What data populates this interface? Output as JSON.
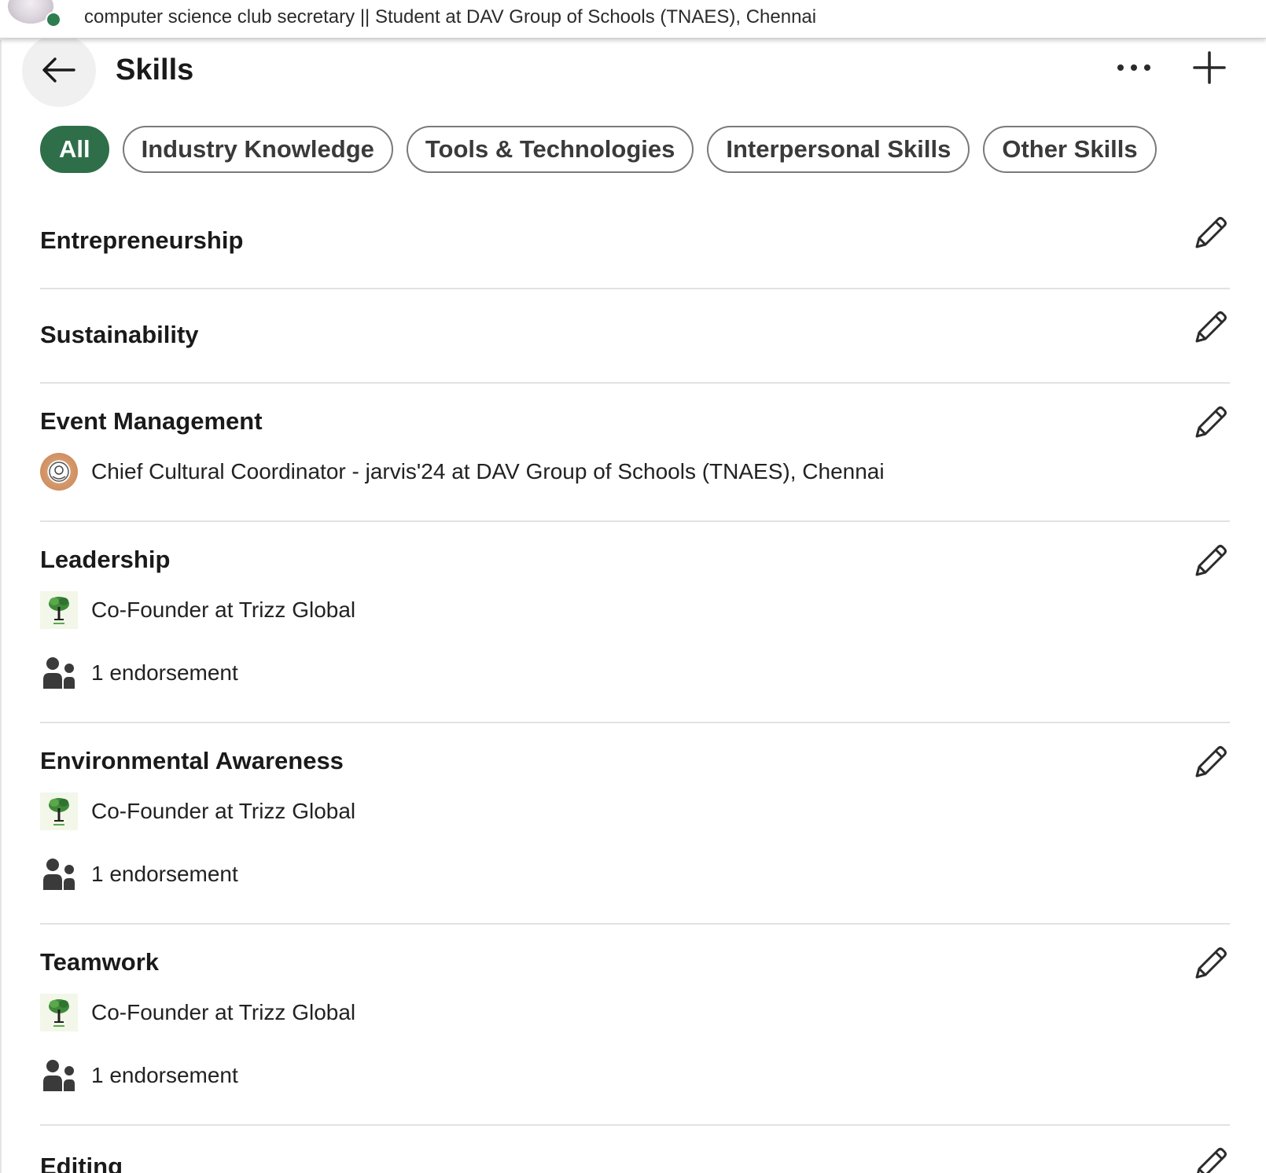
{
  "topbar": {
    "headline": "computer science club secretary || Student at DAV Group of Schools (TNAES), Chennai"
  },
  "header": {
    "title": "Skills"
  },
  "filters": [
    {
      "label": "All",
      "active": true
    },
    {
      "label": "Industry Knowledge",
      "active": false
    },
    {
      "label": "Tools & Technologies",
      "active": false
    },
    {
      "label": "Interpersonal Skills",
      "active": false
    },
    {
      "label": "Other Skills",
      "active": false
    }
  ],
  "skills": [
    {
      "name": "Entrepreneurship"
    },
    {
      "name": "Sustainability"
    },
    {
      "name": "Event Management",
      "source": "Chief Cultural Coordinator - jarvis'24 at DAV Group of Schools (TNAES), Chennai",
      "source_logo": "school-crest-logo"
    },
    {
      "name": "Leadership",
      "source": "Co-Founder at Trizz Global",
      "source_logo": "trizz-tree-logo",
      "endorsements": "1 endorsement"
    },
    {
      "name": "Environmental Awareness",
      "source": "Co-Founder at Trizz Global",
      "source_logo": "trizz-tree-logo",
      "endorsements": "1 endorsement"
    },
    {
      "name": "Teamwork",
      "source": "Co-Founder at Trizz Global",
      "source_logo": "trizz-tree-logo",
      "endorsements": "1 endorsement"
    },
    {
      "name": "Editing"
    }
  ],
  "colors": {
    "accent_green": "#2e6f4a",
    "online_green": "#2e7d4f",
    "pill_border": "#7a7a7a",
    "divider": "#e2e2e2"
  },
  "icons": {
    "back": "arrow-left-icon",
    "more": "more-horizontal-icon",
    "add": "plus-icon",
    "edit": "pencil-icon",
    "endorsement": "people-icon"
  }
}
